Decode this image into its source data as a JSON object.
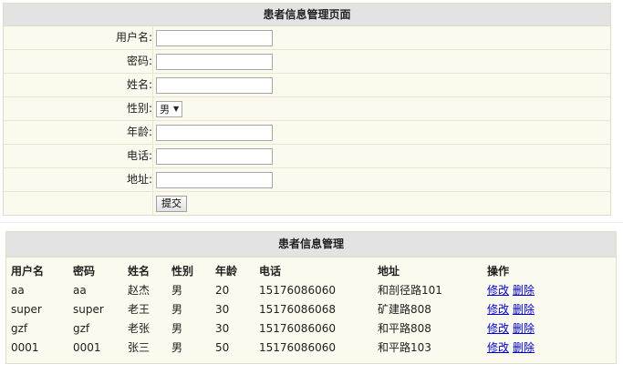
{
  "form": {
    "title": "患者信息管理页面",
    "labels": {
      "username": "用户名:",
      "password": "密码:",
      "name": "姓名:",
      "gender": "性别:",
      "age": "年龄:",
      "phone": "电话:",
      "address": "地址:"
    },
    "gender_selected": "男",
    "submit_label": "提交"
  },
  "table": {
    "title": "患者信息管理",
    "headers": [
      "用户名",
      "密码",
      "姓名",
      "性别",
      "年龄",
      "电话",
      "地址",
      "操作"
    ],
    "rows": [
      [
        "aa",
        "aa",
        "赵杰",
        "男",
        "20",
        "15176086060",
        "和剖径路101"
      ],
      [
        "super",
        "super",
        "老王",
        "男",
        "30",
        "15176086068",
        "矿建路808"
      ],
      [
        "gzf",
        "gzf",
        "老张",
        "男",
        "30",
        "15176086060",
        "和平路808"
      ],
      [
        "0001",
        "0001",
        "张三",
        "男",
        "50",
        "15176086060",
        "和平路103"
      ]
    ],
    "edit_label": "修改",
    "delete_label": "删除"
  },
  "colors": {
    "panel_bg": "#fafaee",
    "header_bg": "#e3e3e3",
    "link": "#0000cc"
  }
}
